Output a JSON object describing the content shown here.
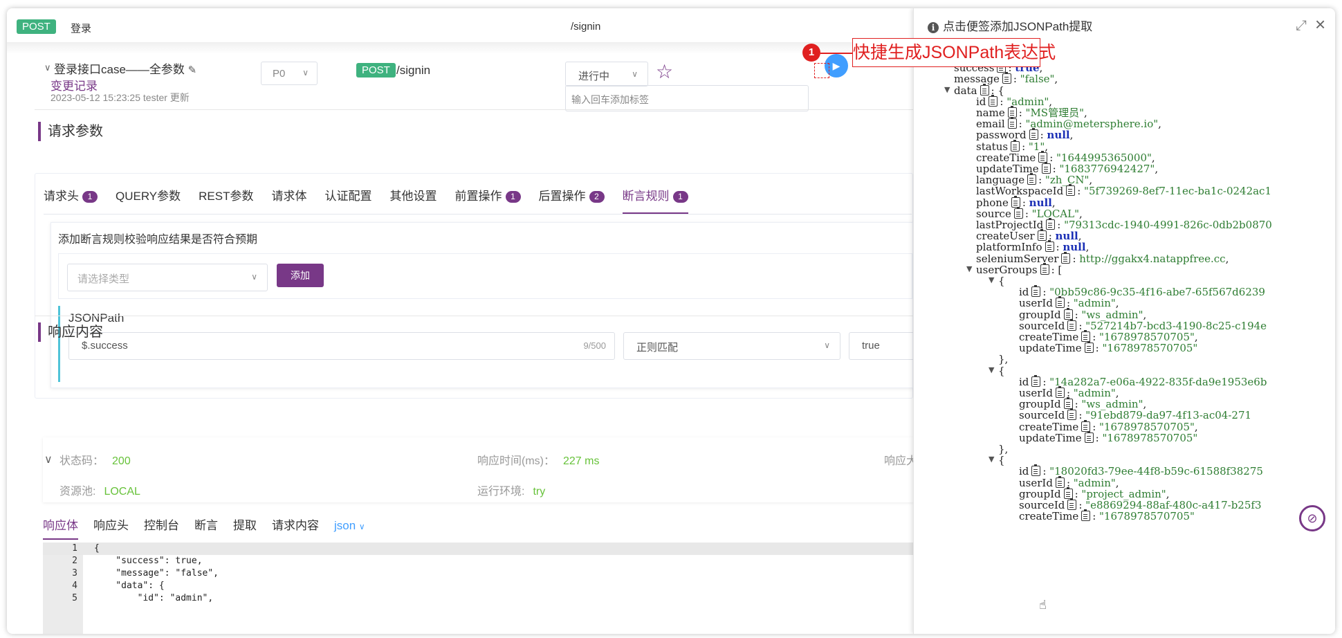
{
  "header": {
    "method": "POST",
    "name": "登录",
    "path": "/signin"
  },
  "case": {
    "title": "登录接口case——全参数",
    "changelog": "变更记录",
    "meta": "2023-05-12 15:23:25 tester 更新",
    "priority": "P0",
    "method": "POST",
    "path": "/signin",
    "status": "进行中",
    "tag_placeholder": "输入回车添加标签"
  },
  "request": {
    "section_title": "请求参数",
    "tabs": [
      {
        "label": "请求头",
        "badge": "1"
      },
      {
        "label": "QUERY参数",
        "badge": ""
      },
      {
        "label": "REST参数",
        "badge": ""
      },
      {
        "label": "请求体",
        "badge": ""
      },
      {
        "label": "认证配置",
        "badge": ""
      },
      {
        "label": "其他设置",
        "badge": ""
      },
      {
        "label": "前置操作",
        "badge": "1"
      },
      {
        "label": "后置操作",
        "badge": "2"
      },
      {
        "label": "断言规则",
        "badge": "1"
      }
    ],
    "assert_hint": "添加断言规则校验响应结果是否符合预期",
    "type_placeholder": "请选择类型",
    "add_label": "添加",
    "jsonpath_label": "JSONPath",
    "jsonpath_value": "$.success",
    "jsonpath_count": "9/500",
    "match_mode": "正则匹配",
    "expected_value": "true"
  },
  "response": {
    "section_title": "响应内容",
    "status_label": "状态码：",
    "status_value": "200",
    "time_label": "响应时间(ms)：",
    "time_value": "227 ms",
    "size_label": "响应大",
    "pool_label": "资源池:",
    "pool_value": "LOCAL",
    "env_label": "运行环境:",
    "env_value": "try",
    "tabs": [
      "响应体",
      "响应头",
      "控制台",
      "断言",
      "提取",
      "请求内容"
    ],
    "format": "json",
    "code_lines": [
      {
        "n": "1",
        "text": "{"
      },
      {
        "n": "2",
        "text": "    \"success\": true,"
      },
      {
        "n": "3",
        "text": "    \"message\": \"false\","
      },
      {
        "n": "4",
        "text": "    \"data\": {"
      },
      {
        "n": "5",
        "text": "        \"id\": \"admin\","
      }
    ]
  },
  "side_panel": {
    "title": "点击便签添加JSONPath提取",
    "callout_number": "1",
    "callout_text": "快捷生成JSONPath表达式",
    "tree": [
      {
        "indent": 0,
        "tri": true,
        "text": "{"
      },
      {
        "indent": 1,
        "key": "success",
        "val": "true",
        "type": "n",
        "tail": ","
      },
      {
        "indent": 1,
        "key": "message",
        "val": "\"false\"",
        "type": "s",
        "tail": ","
      },
      {
        "indent": 1,
        "tri": true,
        "key": "data",
        "val": "{",
        "type": "p"
      },
      {
        "indent": 2,
        "key": "id",
        "val": "\"admin\"",
        "type": "s",
        "tail": ","
      },
      {
        "indent": 2,
        "key": "name",
        "val": "\"MS管理员\"",
        "type": "s",
        "tail": ","
      },
      {
        "indent": 2,
        "key": "email",
        "val": "\"admin@metersphere.io\"",
        "type": "s",
        "tail": ","
      },
      {
        "indent": 2,
        "key": "password",
        "val": "null",
        "type": "n",
        "tail": ","
      },
      {
        "indent": 2,
        "key": "status",
        "val": "\"1\"",
        "type": "s",
        "tail": ","
      },
      {
        "indent": 2,
        "key": "createTime",
        "val": "\"1644995365000\"",
        "type": "s",
        "tail": ","
      },
      {
        "indent": 2,
        "key": "updateTime",
        "val": "\"1683776942427\"",
        "type": "s",
        "tail": ","
      },
      {
        "indent": 2,
        "key": "language",
        "val": "\"zh_CN\"",
        "type": "s",
        "tail": ","
      },
      {
        "indent": 2,
        "key": "lastWorkspaceId",
        "val": "\"5f739269-8ef7-11ec-ba1c-0242ac1",
        "type": "s",
        "tail": ""
      },
      {
        "indent": 2,
        "key": "phone",
        "val": "null",
        "type": "n",
        "tail": ","
      },
      {
        "indent": 2,
        "key": "source",
        "val": "\"LOCAL\"",
        "type": "s",
        "tail": ","
      },
      {
        "indent": 2,
        "key": "lastProjectId",
        "val": "\"79313cdc-1940-4991-826c-0db2b0870",
        "type": "s",
        "tail": ""
      },
      {
        "indent": 2,
        "key": "createUser",
        "val": "null",
        "type": "n",
        "tail": ","
      },
      {
        "indent": 2,
        "key": "platformInfo",
        "val": "null",
        "type": "n",
        "tail": ","
      },
      {
        "indent": 2,
        "key": "seleniumServer",
        "val": "http://ggakx4.natappfree.cc",
        "type": "u",
        "tail": ","
      },
      {
        "indent": 2,
        "tri": true,
        "key": "userGroups",
        "val": "[",
        "type": "p"
      },
      {
        "indent": 3,
        "tri": true,
        "text": "{"
      },
      {
        "indent": 4,
        "key": "id",
        "val": "\"0bb59c86-9c35-4f16-abe7-65f567d6239",
        "type": "s",
        "tail": ""
      },
      {
        "indent": 4,
        "key": "userId",
        "val": "\"admin\"",
        "type": "s",
        "tail": ","
      },
      {
        "indent": 4,
        "key": "groupId",
        "val": "\"ws_admin\"",
        "type": "s",
        "tail": ","
      },
      {
        "indent": 4,
        "key": "sourceId",
        "val": "\"527214b7-bcd3-4190-8c25-c194e",
        "type": "s",
        "tail": ""
      },
      {
        "indent": 4,
        "key": "createTime",
        "val": "\"1678978570705\"",
        "type": "s",
        "tail": ","
      },
      {
        "indent": 4,
        "key": "updateTime",
        "val": "\"1678978570705\"",
        "type": "s",
        "tail": ""
      },
      {
        "indent": 3,
        "text": "},"
      },
      {
        "indent": 3,
        "tri": true,
        "text": "{"
      },
      {
        "indent": 4,
        "key": "id",
        "val": "\"14a282a7-e06a-4922-835f-da9e1953e6b",
        "type": "s",
        "tail": ""
      },
      {
        "indent": 4,
        "key": "userId",
        "val": "\"admin\"",
        "type": "s",
        "tail": ","
      },
      {
        "indent": 4,
        "key": "groupId",
        "val": "\"ws_admin\"",
        "type": "s",
        "tail": ","
      },
      {
        "indent": 4,
        "key": "sourceId",
        "val": "\"91ebd879-da97-4f13-ac04-271",
        "type": "s",
        "tail": ""
      },
      {
        "indent": 4,
        "key": "createTime",
        "val": "\"1678978570705\"",
        "type": "s",
        "tail": ","
      },
      {
        "indent": 4,
        "key": "updateTime",
        "val": "\"1678978570705\"",
        "type": "s",
        "tail": ""
      },
      {
        "indent": 3,
        "text": "},"
      },
      {
        "indent": 3,
        "tri": true,
        "text": "{"
      },
      {
        "indent": 4,
        "key": "id",
        "val": "\"18020fd3-79ee-44f8-b59c-61588f38275",
        "type": "s",
        "tail": ""
      },
      {
        "indent": 4,
        "key": "userId",
        "val": "\"admin\"",
        "type": "s",
        "tail": ","
      },
      {
        "indent": 4,
        "key": "groupId",
        "val": "\"project_admin\"",
        "type": "s",
        "tail": ","
      },
      {
        "indent": 4,
        "key": "sourceId",
        "val": "\"e8869294-88af-480c-a417-b25f3",
        "type": "s",
        "tail": ""
      },
      {
        "indent": 4,
        "key": "createTime",
        "val": "\"1678978570705\"",
        "type": "s",
        "tail": ""
      }
    ]
  }
}
